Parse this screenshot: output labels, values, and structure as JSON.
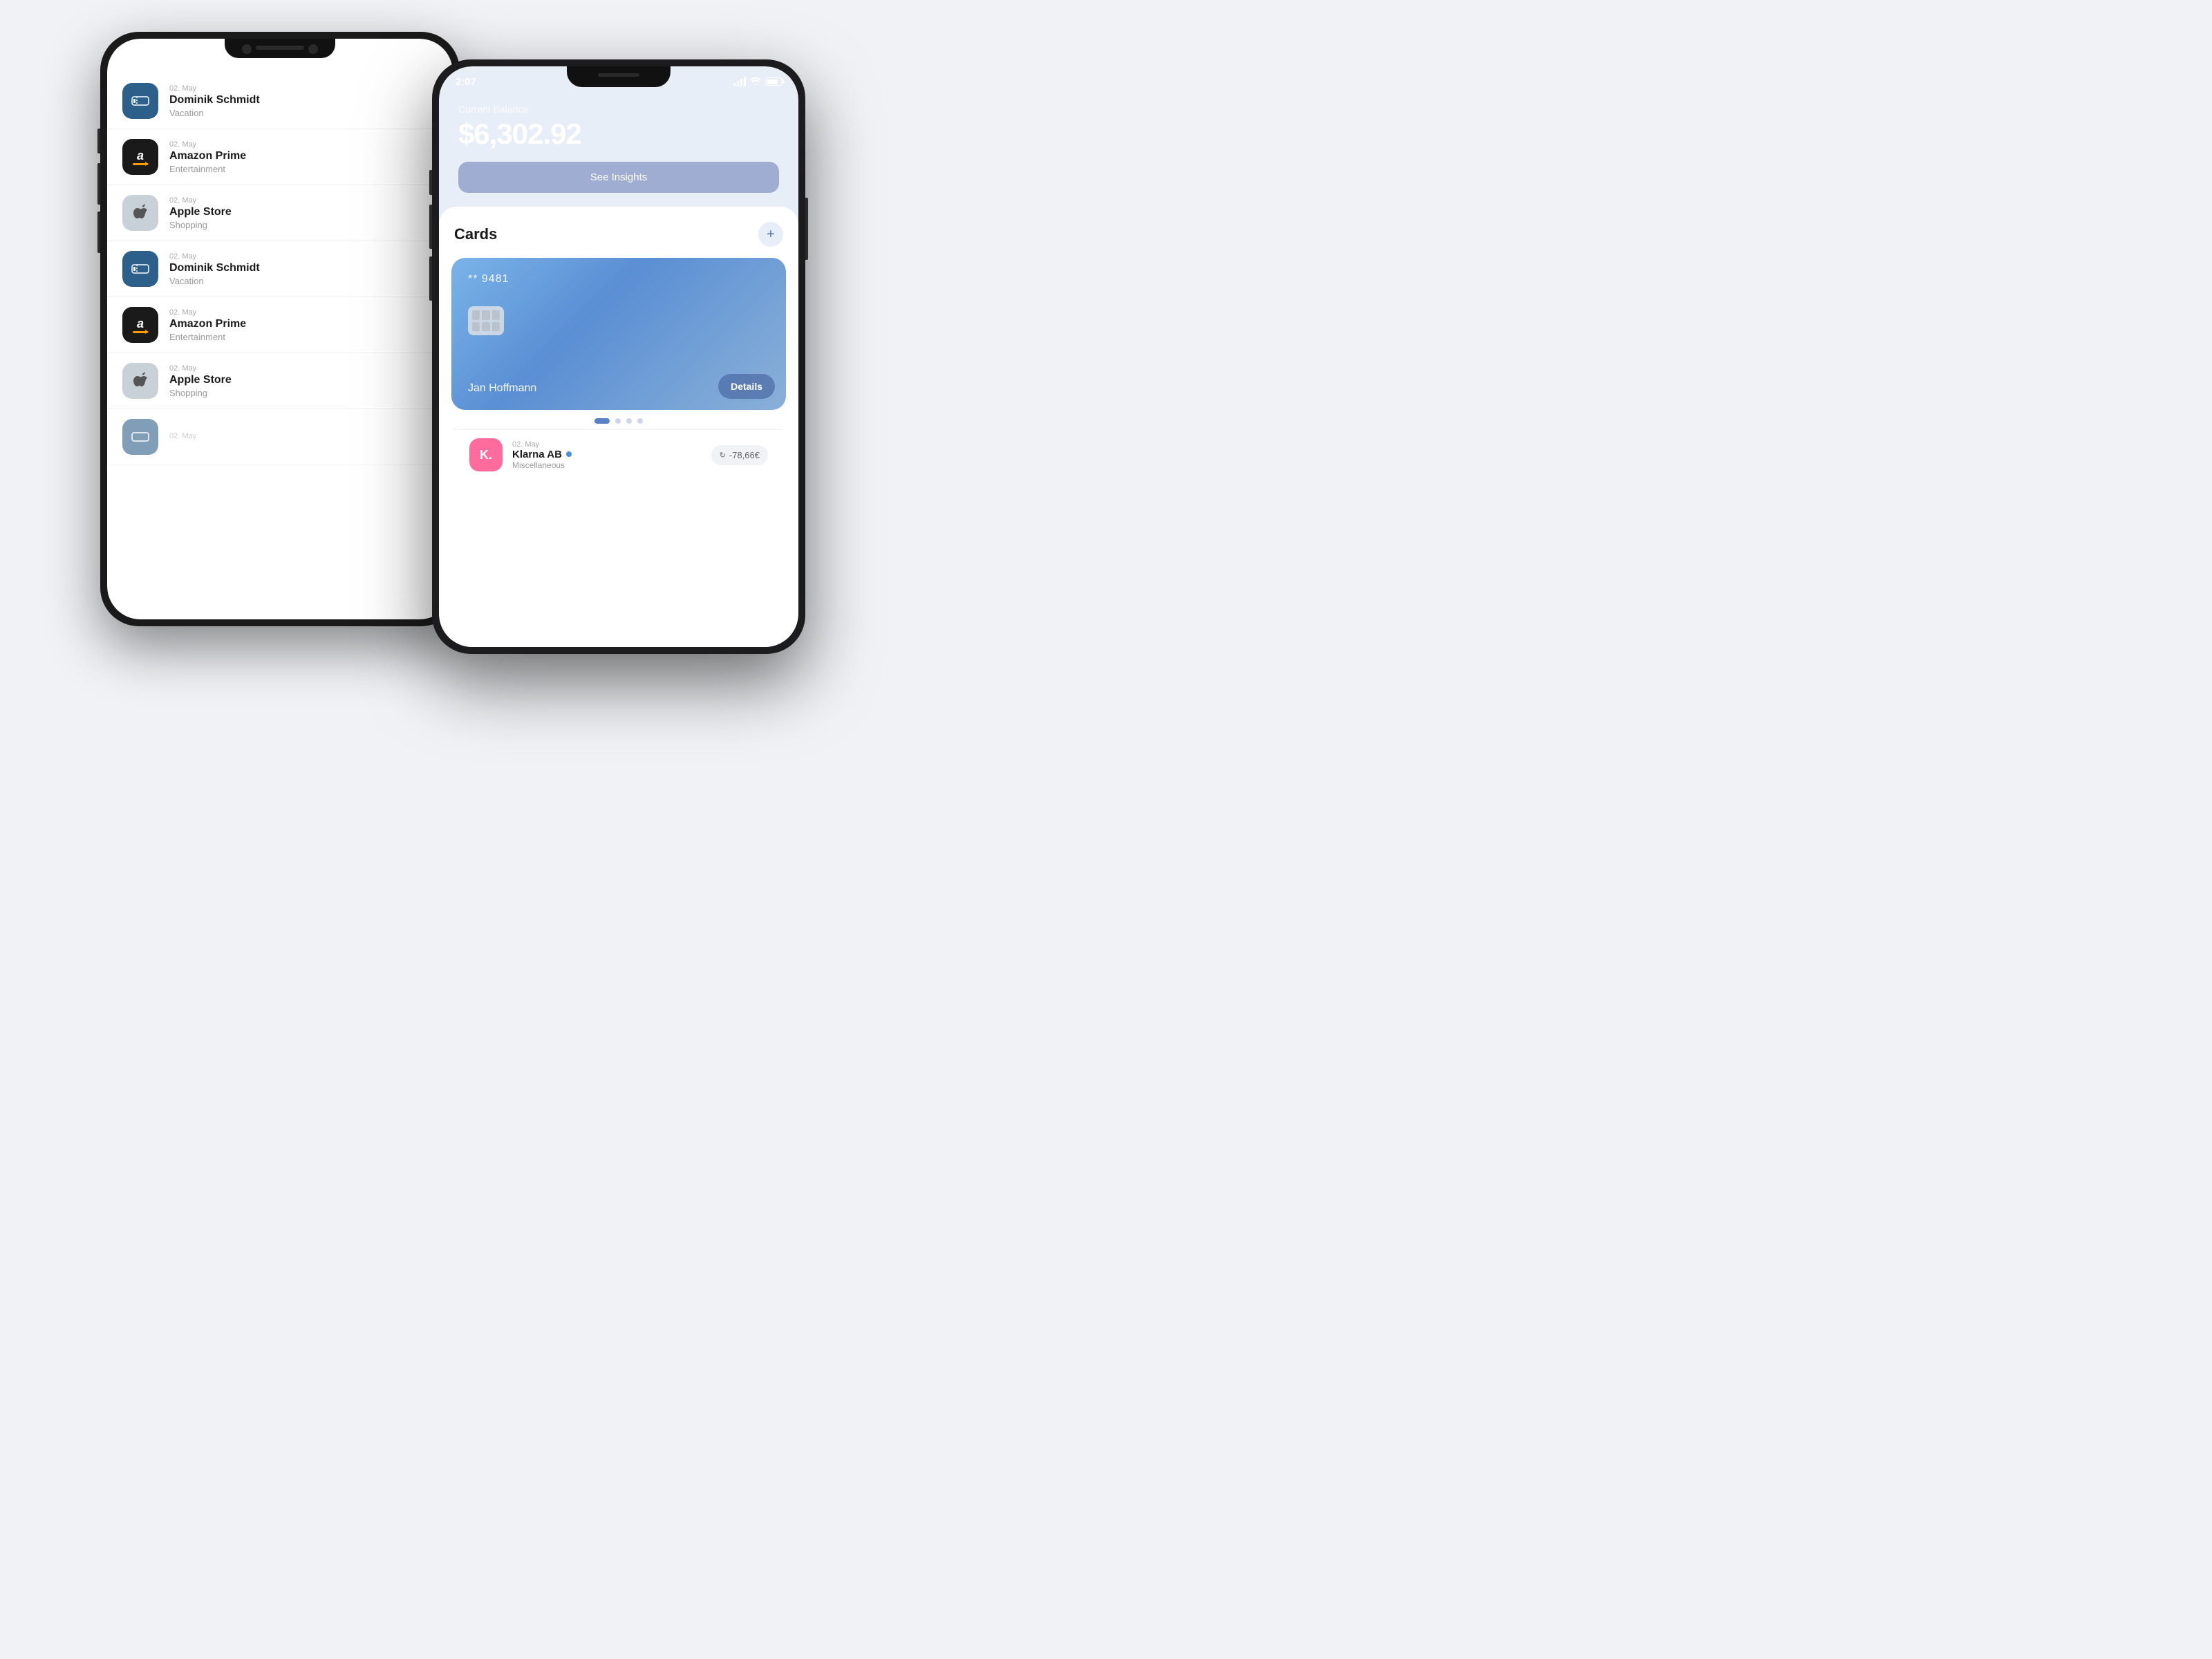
{
  "scene": {
    "background_color": "#f0f2f5"
  },
  "back_phone": {
    "transactions": [
      {
        "id": "tx1",
        "date": "02. May",
        "name": "Dominik Schmidt",
        "category": "Vacation",
        "icon_type": "vacation"
      },
      {
        "id": "tx2",
        "date": "02. May",
        "name": "Amazon Prime",
        "category": "Entertainment",
        "icon_type": "amazon"
      },
      {
        "id": "tx3",
        "date": "02. May",
        "name": "Apple Store",
        "category": "Shopping",
        "icon_type": "apple"
      },
      {
        "id": "tx4",
        "date": "02. May",
        "name": "Dominik Schmidt",
        "category": "Vacation",
        "icon_type": "vacation"
      },
      {
        "id": "tx5",
        "date": "02. May",
        "name": "Amazon Prime",
        "category": "Entertainment",
        "icon_type": "amazon"
      },
      {
        "id": "tx6",
        "date": "02. May",
        "name": "Apple Store",
        "category": "Shopping",
        "icon_type": "apple"
      },
      {
        "id": "tx7",
        "date": "02. May",
        "name": "",
        "category": "",
        "icon_type": "vacation"
      }
    ]
  },
  "front_phone": {
    "status_bar": {
      "time": "2:07"
    },
    "balance": {
      "label": "Current Balance",
      "amount": "$6,302.92"
    },
    "insights_button": {
      "label": "See Insights"
    },
    "cards_section": {
      "title": "Cards",
      "add_button_label": "+",
      "card": {
        "number": "** 9481",
        "holder": "Jan Hoffmann",
        "details_button": "Details"
      },
      "dots": [
        {
          "active": true
        },
        {
          "active": false
        },
        {
          "active": false
        },
        {
          "active": false
        }
      ]
    },
    "transaction": {
      "date": "02. May",
      "name": "Klarna AB",
      "online_indicator": true,
      "category": "Miscellaneous",
      "amount": "-78,66€",
      "icon_label": "K."
    }
  }
}
